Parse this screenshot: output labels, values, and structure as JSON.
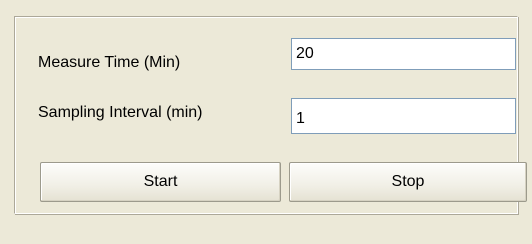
{
  "form": {
    "measure_time_label": "Measure Time (Min)",
    "measure_time_value": "20",
    "sampling_interval_label": "Sampling Interval (min)",
    "sampling_interval_value": "1"
  },
  "buttons": {
    "start_label": "Start",
    "stop_label": "Stop"
  },
  "colors": {
    "window_background": "#ece9d8",
    "field_border": "#7f9db9",
    "field_background": "#ffffff"
  }
}
